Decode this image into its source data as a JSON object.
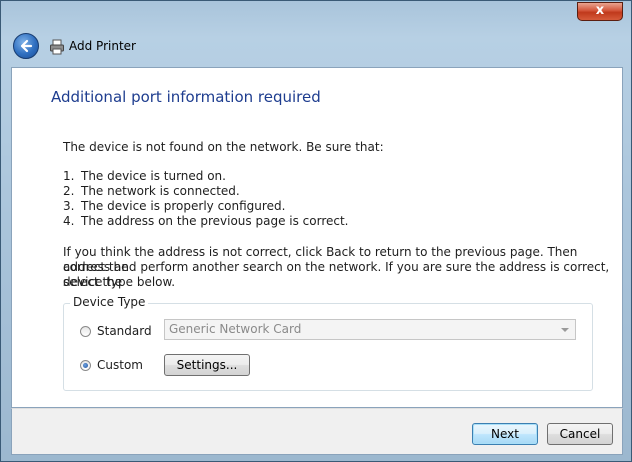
{
  "window": {
    "close_glyph": "x"
  },
  "nav": {
    "title": "Add Printer",
    "back_icon": "back-arrow-icon",
    "printer_icon": "printer-icon"
  },
  "main": {
    "heading": "Additional port information required",
    "intro": "The device is not found on the network.  Be sure that:",
    "checklist": [
      {
        "num": "1.",
        "text": "The device is turned on."
      },
      {
        "num": "2.",
        "text": "The network is connected."
      },
      {
        "num": "3.",
        "text": "The device is properly configured."
      },
      {
        "num": "4.",
        "text": "The address on the previous page is correct."
      }
    ],
    "paragraph_lines": [
      "If you think the address is not correct, click Back to return to the previous page.  Then correct the",
      "address and perform another search on the network.  If you are sure the address is correct, select the",
      "device type below."
    ],
    "device_type": {
      "legend": "Device Type",
      "standard_label": "Standard",
      "standard_checked": false,
      "standard_select_value": "Generic Network Card",
      "custom_label": "Custom",
      "custom_checked": true,
      "settings_button": "Settings..."
    }
  },
  "footer": {
    "next_label": "Next",
    "cancel_label": "Cancel"
  }
}
